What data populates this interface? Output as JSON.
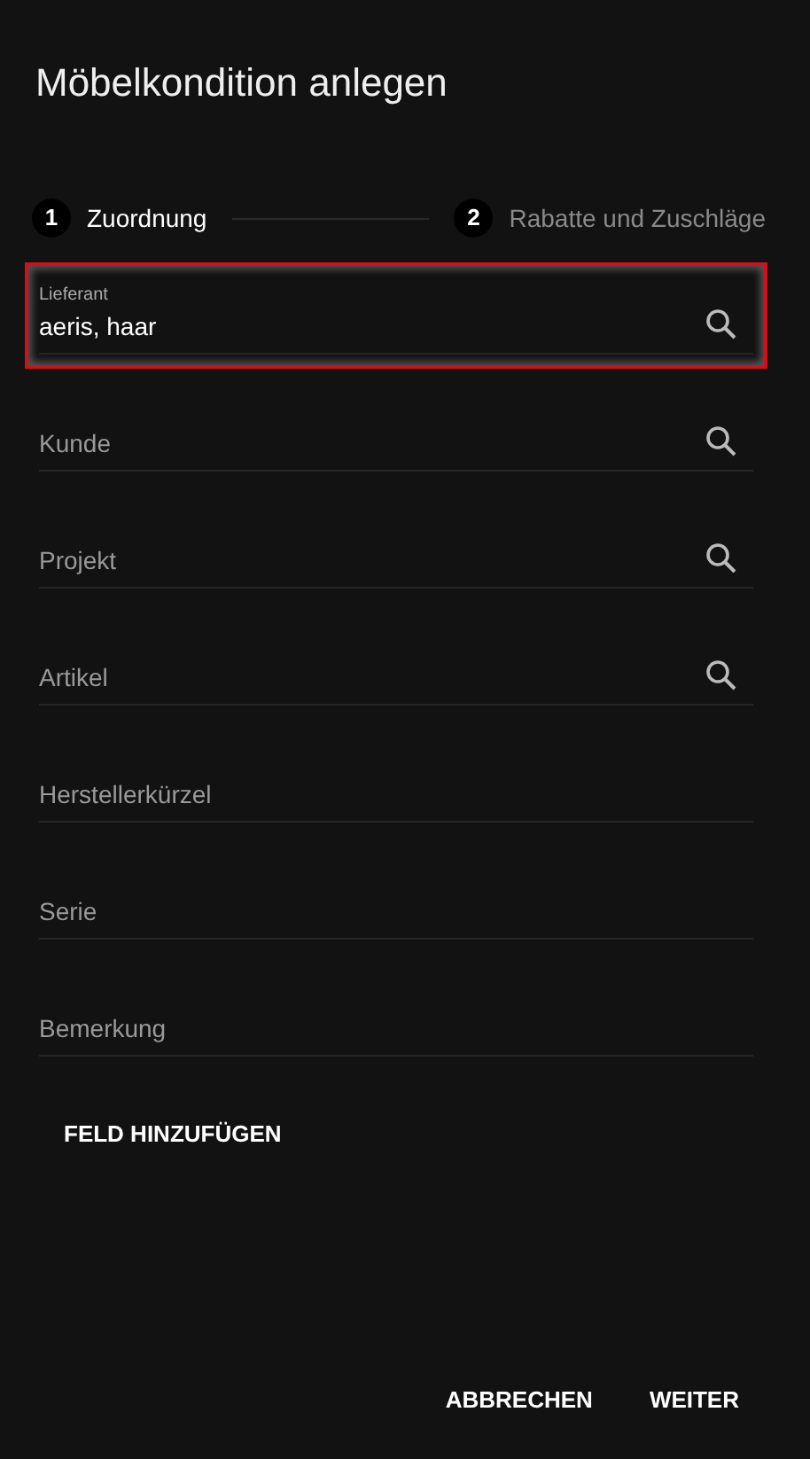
{
  "dialog": {
    "title": "Möbelkondition anlegen"
  },
  "steps": [
    {
      "number": "1",
      "label": "Zuordnung",
      "selected": true
    },
    {
      "number": "2",
      "label": "Rabatte und Zuschläge",
      "selected": false
    }
  ],
  "fields": [
    {
      "kind": "search",
      "label": "Lieferant",
      "value": "aeris, haar",
      "highlighted": true
    },
    {
      "kind": "search",
      "placeholder": "Kunde",
      "highlighted": false
    },
    {
      "kind": "search",
      "placeholder": "Projekt",
      "highlighted": false
    },
    {
      "kind": "search",
      "placeholder": "Artikel",
      "highlighted": false
    },
    {
      "kind": "plain",
      "placeholder": "Herstellerkürzel",
      "highlighted": false
    },
    {
      "kind": "plain",
      "placeholder": "Serie",
      "highlighted": false
    },
    {
      "kind": "plain",
      "placeholder": "Bemerkung",
      "highlighted": false
    }
  ],
  "add_field_button": "FELD HINZUFÜGEN",
  "buttons": [
    "ABBRECHEN",
    "WEITER"
  ]
}
